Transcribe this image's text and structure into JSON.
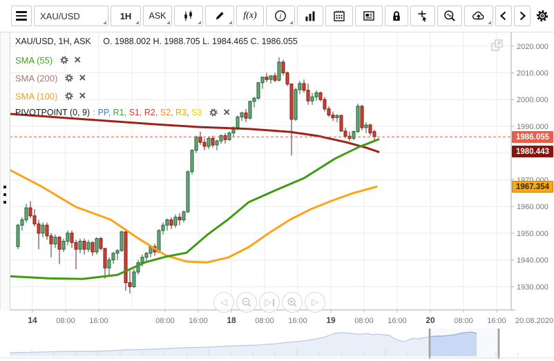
{
  "toolbar": {
    "symbol": "XAU/USD",
    "timeframe": "1H",
    "price_type": "ASK",
    "fx_label": "f(x)"
  },
  "legend": {
    "ohlc_left": "XAU/USD, 1H, ASK",
    "ohlc_right": "O. 1988.002 H. 1988.705 L. 1984.465 C. 1986.055",
    "indicators": [
      {
        "label": "SMA (55)",
        "color": "#459f1d"
      },
      {
        "label": "SMA (200)",
        "color": "#b4726b"
      },
      {
        "label": "SMA (100)",
        "color": "#f9a11b"
      }
    ],
    "pivot": {
      "label": "PIVOTPOINT (0, 9)",
      "sep": ":",
      "levels": [
        {
          "t": "PP",
          "c": "#2a7fe0"
        },
        {
          "t": "R1",
          "c": "#3fa33c"
        },
        {
          "t": "S1",
          "c": "#e23d2e"
        },
        {
          "t": "R2",
          "c": "#e23d2e"
        },
        {
          "t": "S2",
          "c": "#f78b1f"
        },
        {
          "t": "R3",
          "c": "#f0a500"
        },
        {
          "t": "S3",
          "c": "#f2d40a"
        }
      ]
    }
  },
  "price_axis": {
    "ticks": [
      {
        "label": "2020.000",
        "price": 2020
      },
      {
        "label": "2010.000",
        "price": 2010
      },
      {
        "label": "2000.000",
        "price": 2000
      },
      {
        "label": "1990.000",
        "price": 1990
      },
      {
        "label": "1970.000",
        "price": 1970
      },
      {
        "label": "1960.000",
        "price": 1960
      },
      {
        "label": "1950.000",
        "price": 1950
      },
      {
        "label": "1940.000",
        "price": 1940
      },
      {
        "label": "1930.000",
        "price": 1930
      }
    ],
    "date_label": "20.08.2020"
  },
  "time_axis": [
    {
      "x": 47,
      "label": "14",
      "bold": true
    },
    {
      "x": 95,
      "label": "08:00",
      "bold": false
    },
    {
      "x": 143,
      "label": "16:00",
      "bold": false
    },
    {
      "x": 239,
      "label": "08:00",
      "bold": false
    },
    {
      "x": 287,
      "label": "16:00",
      "bold": false
    },
    {
      "x": 335,
      "label": "18",
      "bold": true
    },
    {
      "x": 383,
      "label": "08:00",
      "bold": false
    },
    {
      "x": 431,
      "label": "16:00",
      "bold": false
    },
    {
      "x": 479,
      "label": "19",
      "bold": true
    },
    {
      "x": 527,
      "label": "08:00",
      "bold": false
    },
    {
      "x": 575,
      "label": "16:00",
      "bold": false
    },
    {
      "x": 623,
      "label": "20",
      "bold": true
    },
    {
      "x": 671,
      "label": "08:00",
      "bold": false
    },
    {
      "x": 719,
      "label": "16:00",
      "bold": false
    }
  ],
  "badges": [
    {
      "label": "1986.055",
      "price": 1986.055,
      "bg": "#e2614e",
      "fg": "#ffffff",
      "border": "#e2614e"
    },
    {
      "label": "1980.443",
      "price": 1980.443,
      "bg": "#8a130b",
      "fg": "#ffffff",
      "border": "#8a130b"
    },
    {
      "label": "1967.354",
      "price": 1967.354,
      "bg": "#f7a71b",
      "fg": "#3a2a00",
      "border": "#c5830a"
    }
  ],
  "chart_data": {
    "type": "candlestick",
    "symbol": "XAU/USD",
    "interval": "1H",
    "current_price": 1986.055,
    "ylim": [
      1921.3,
      2025.1
    ],
    "grid_prices": [
      1930,
      1940,
      1950,
      1960,
      1970,
      1980,
      1990,
      2000,
      2010,
      2020
    ],
    "grid_x": [
      47,
      95,
      143,
      191,
      239,
      287,
      335,
      383,
      431,
      479,
      527,
      575,
      623,
      671,
      719
    ],
    "x_start": 26,
    "x_step": 6,
    "candles": [
      [
        1945.0,
        1953.5,
        1944.0,
        1953.0
      ],
      [
        1953.0,
        1956.0,
        1951.0,
        1955.0
      ],
      [
        1955.0,
        1961.0,
        1954.0,
        1959.5
      ],
      [
        1959.5,
        1962.0,
        1955.5,
        1956.5
      ],
      [
        1956.5,
        1959.0,
        1952.5,
        1953.5
      ],
      [
        1953.5,
        1955.0,
        1944.0,
        1950.0
      ],
      [
        1950.0,
        1954.0,
        1948.5,
        1953.0
      ],
      [
        1953.0,
        1954.0,
        1947.5,
        1949.0
      ],
      [
        1949.0,
        1950.0,
        1941.0,
        1946.0
      ],
      [
        1946.0,
        1949.5,
        1944.5,
        1948.5
      ],
      [
        1948.5,
        1949.0,
        1938.5,
        1944.0
      ],
      [
        1944.0,
        1948.0,
        1943.0,
        1947.0
      ],
      [
        1947.0,
        1951.0,
        1945.5,
        1950.0
      ],
      [
        1950.0,
        1951.0,
        1944.5,
        1946.5
      ],
      [
        1946.5,
        1947.5,
        1936.5,
        1944.0
      ],
      [
        1944.0,
        1948.0,
        1942.5,
        1947.0
      ],
      [
        1947.0,
        1948.0,
        1942.0,
        1944.0
      ],
      [
        1944.0,
        1947.5,
        1943.0,
        1946.5
      ],
      [
        1946.5,
        1947.0,
        1941.5,
        1943.0
      ],
      [
        1943.0,
        1948.5,
        1942.0,
        1948.0
      ],
      [
        1948.0,
        1948.6,
        1943.5,
        1944.3
      ],
      [
        1944.3,
        1944.5,
        1933.0,
        1937.0
      ],
      [
        1937.0,
        1941.0,
        1934.0,
        1940.0
      ],
      [
        1940.0,
        1943.0,
        1938.5,
        1942.5
      ],
      [
        1942.5,
        1944.0,
        1940.0,
        1943.5
      ],
      [
        1943.5,
        1951.0,
        1943.0,
        1950.5
      ],
      [
        1950.5,
        1951.5,
        1928.5,
        1931.5
      ],
      [
        1931.5,
        1936.0,
        1927.5,
        1930.0
      ],
      [
        1930.0,
        1936.5,
        1929.5,
        1935.5
      ],
      [
        1935.5,
        1940.0,
        1934.5,
        1939.0
      ],
      [
        1939.0,
        1942.0,
        1937.5,
        1941.0
      ],
      [
        1941.0,
        1943.0,
        1939.0,
        1942.5
      ],
      [
        1942.5,
        1945.5,
        1941.0,
        1945.0
      ],
      [
        1945.0,
        1946.0,
        1941.5,
        1943.0
      ],
      [
        1943.0,
        1951.5,
        1942.5,
        1951.0
      ],
      [
        1951.0,
        1954.0,
        1949.5,
        1953.0
      ],
      [
        1953.0,
        1955.5,
        1951.0,
        1955.0
      ],
      [
        1955.0,
        1956.0,
        1951.5,
        1953.0
      ],
      [
        1953.0,
        1957.0,
        1952.0,
        1956.0
      ],
      [
        1956.0,
        1957.5,
        1953.0,
        1955.0
      ],
      [
        1955.0,
        1958.5,
        1954.0,
        1958.0
      ],
      [
        1958.0,
        1973.5,
        1957.5,
        1973.0
      ],
      [
        1973.0,
        1981.5,
        1972.0,
        1981.0
      ],
      [
        1981.0,
        1986.5,
        1980.0,
        1986.0
      ],
      [
        1986.0,
        1988.0,
        1983.0,
        1984.0
      ],
      [
        1984.0,
        1985.5,
        1981.0,
        1982.5
      ],
      [
        1982.5,
        1986.0,
        1981.5,
        1985.5
      ],
      [
        1985.5,
        1986.5,
        1982.0,
        1983.0
      ],
      [
        1983.0,
        1985.0,
        1981.0,
        1984.5
      ],
      [
        1984.5,
        1987.0,
        1983.5,
        1986.5
      ],
      [
        1986.5,
        1987.5,
        1983.5,
        1985.0
      ],
      [
        1985.0,
        1988.0,
        1984.5,
        1987.5
      ],
      [
        1987.5,
        1990.0,
        1986.0,
        1989.5
      ],
      [
        1989.5,
        1994.0,
        1988.5,
        1993.5
      ],
      [
        1993.5,
        1995.5,
        1992.0,
        1995.0
      ],
      [
        1995.0,
        1996.5,
        1991.5,
        1993.0
      ],
      [
        1993.0,
        1999.5,
        1992.5,
        1999.3
      ],
      [
        1999.3,
        2001.0,
        1997.0,
        2000.5
      ],
      [
        2000.5,
        2006.5,
        2000.0,
        2006.3
      ],
      [
        2006.3,
        2008.5,
        2004.0,
        2008.4
      ],
      [
        2008.4,
        2010.0,
        2006.5,
        2007.5
      ],
      [
        2007.5,
        2009.0,
        2006.0,
        2008.9
      ],
      [
        2008.9,
        2010.0,
        2006.5,
        2007.2
      ],
      [
        2007.2,
        2015.8,
        2006.8,
        2014.0
      ],
      [
        2014.0,
        2014.8,
        2009.0,
        2010.0
      ],
      [
        2010.0,
        2010.5,
        2005.0,
        2005.8
      ],
      [
        2005.8,
        2006.0,
        1979.0,
        1992.6
      ],
      [
        1992.6,
        2004.5,
        1992.0,
        2003.7
      ],
      [
        2003.7,
        2007.0,
        2002.0,
        2006.0
      ],
      [
        2006.0,
        2007.5,
        2002.5,
        2003.5
      ],
      [
        2003.5,
        2006.0,
        1998.0,
        1999.5
      ],
      [
        1999.5,
        2002.5,
        1998.0,
        2001.0
      ],
      [
        2001.0,
        2003.5,
        1999.5,
        2002.5
      ],
      [
        2002.5,
        2003.0,
        1999.3,
        2000.0
      ],
      [
        2000.0,
        2001.0,
        1995.5,
        1996.5
      ],
      [
        1996.5,
        1997.5,
        1993.5,
        1994.2
      ],
      [
        1994.2,
        1995.5,
        1992.0,
        1993.2
      ],
      [
        1993.2,
        1994.5,
        1991.5,
        1994.0
      ],
      [
        1994.0,
        1994.5,
        1988.0,
        1988.2
      ],
      [
        1988.2,
        1989.5,
        1985.5,
        1986.3
      ],
      [
        1986.3,
        1988.0,
        1984.5,
        1985.5
      ],
      [
        1985.5,
        1988.5,
        1984.8,
        1988.0
      ],
      [
        1988.0,
        1998.5,
        1987.5,
        1997.5
      ],
      [
        1997.5,
        1998.0,
        1988.5,
        1989.5
      ],
      [
        1989.5,
        1991.5,
        1987.5,
        1990.5
      ],
      [
        1990.5,
        1991.0,
        1986.5,
        1987.5
      ],
      [
        1988.0,
        1988.7,
        1984.5,
        1986.1
      ]
    ],
    "sma55": [
      [
        14,
        1933.9
      ],
      [
        70,
        1933.1
      ],
      [
        120,
        1932.9
      ],
      [
        170,
        1934.4
      ],
      [
        210,
        1939.1
      ],
      [
        240,
        1941.2
      ],
      [
        270,
        1942.7
      ],
      [
        300,
        1949.4
      ],
      [
        330,
        1955.1
      ],
      [
        360,
        1961.6
      ],
      [
        400,
        1966.2
      ],
      [
        440,
        1970.6
      ],
      [
        485,
        1977.9
      ],
      [
        520,
        1982.3
      ],
      [
        548,
        1985.1
      ]
    ],
    "sma100": [
      [
        14,
        1973.7
      ],
      [
        60,
        1967.5
      ],
      [
        110,
        1959.8
      ],
      [
        160,
        1955.1
      ],
      [
        200,
        1948.1
      ],
      [
        240,
        1941.7
      ],
      [
        270,
        1939.4
      ],
      [
        300,
        1939.1
      ],
      [
        330,
        1940.9
      ],
      [
        360,
        1944.8
      ],
      [
        390,
        1950.2
      ],
      [
        420,
        1955.1
      ],
      [
        450,
        1959.0
      ],
      [
        480,
        1962.1
      ],
      [
        510,
        1964.9
      ],
      [
        545,
        1967.4
      ]
    ],
    "sma200": [
      [
        16,
        1994.6
      ],
      [
        80,
        1993.4
      ],
      [
        150,
        1992.1
      ],
      [
        220,
        1990.8
      ],
      [
        290,
        1989.7
      ],
      [
        360,
        1989.0
      ],
      [
        420,
        1987.9
      ],
      [
        460,
        1986.4
      ],
      [
        500,
        1984.1
      ],
      [
        530,
        1982.0
      ],
      [
        548,
        1980.4
      ]
    ],
    "colors": {
      "up_fill": "#6aa879",
      "up_stroke": "#1f5e38",
      "down_fill": "#ca4335",
      "down_stroke": "#7a1c10",
      "sma55": "#3f9a14",
      "sma100": "#ffa316",
      "sma200": "#9c2318",
      "dashed": "#d9604f",
      "grid": "#ececec",
      "axis": "#aaaaaa",
      "text": "#777777"
    }
  },
  "navigator": {
    "points": [
      [
        14,
        31
      ],
      [
        60,
        30
      ],
      [
        100,
        29
      ],
      [
        140,
        29
      ],
      [
        180,
        27
      ],
      [
        220,
        26
      ],
      [
        260,
        24
      ],
      [
        300,
        23
      ],
      [
        340,
        21
      ],
      [
        370,
        20
      ],
      [
        400,
        18
      ],
      [
        415,
        16
      ],
      [
        430,
        15
      ],
      [
        445,
        13
      ],
      [
        458,
        11
      ],
      [
        468,
        9
      ],
      [
        476,
        6
      ],
      [
        484,
        3
      ],
      [
        492,
        2
      ],
      [
        500,
        2
      ],
      [
        508,
        3
      ],
      [
        516,
        4
      ],
      [
        524,
        4
      ],
      [
        532,
        3
      ],
      [
        540,
        5
      ],
      [
        548,
        4
      ],
      [
        556,
        5
      ],
      [
        564,
        6
      ],
      [
        572,
        11
      ],
      [
        580,
        14
      ],
      [
        586,
        15
      ],
      [
        592,
        12
      ],
      [
        598,
        10
      ],
      [
        606,
        11
      ],
      [
        614,
        9
      ],
      [
        622,
        8
      ],
      [
        630,
        7
      ],
      [
        640,
        7
      ],
      [
        650,
        6
      ],
      [
        658,
        5
      ],
      [
        666,
        3
      ],
      [
        674,
        2
      ],
      [
        682,
        1
      ],
      [
        690,
        3
      ]
    ],
    "end_x": 690,
    "window": [
      622,
      722
    ],
    "fill": "#e9eff9",
    "stroke": "#b8c8e8",
    "win_fill": "#cddcf6",
    "win_stroke": "#93aede"
  }
}
